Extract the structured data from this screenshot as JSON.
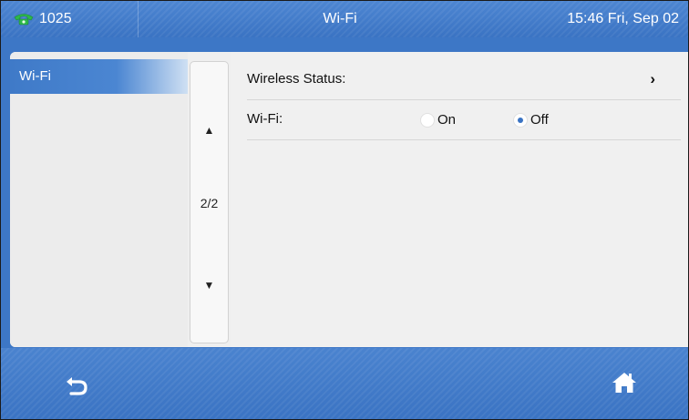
{
  "header": {
    "line_number": "1025",
    "title": "Wi-Fi",
    "clock": "15:46 Fri, Sep 02",
    "line_icon": "phone-icon",
    "line_icon_color": "#2db84a"
  },
  "sidebar": {
    "items": [
      {
        "label": "Wi-Fi",
        "selected": true
      }
    ]
  },
  "pager": {
    "up_icon": "▲",
    "page": "2/2",
    "down_icon": "▼"
  },
  "settings": {
    "wireless_status": {
      "label": "Wireless Status:",
      "chevron": "›"
    },
    "wifi": {
      "label": "Wi-Fi:",
      "options": [
        {
          "label": "On",
          "selected": false
        },
        {
          "label": "Off",
          "selected": true
        }
      ]
    }
  },
  "footer": {
    "back_icon": "back-icon",
    "home_icon": "home-icon"
  },
  "colors": {
    "accent": "#3d77c6",
    "panel": "#efefef"
  }
}
